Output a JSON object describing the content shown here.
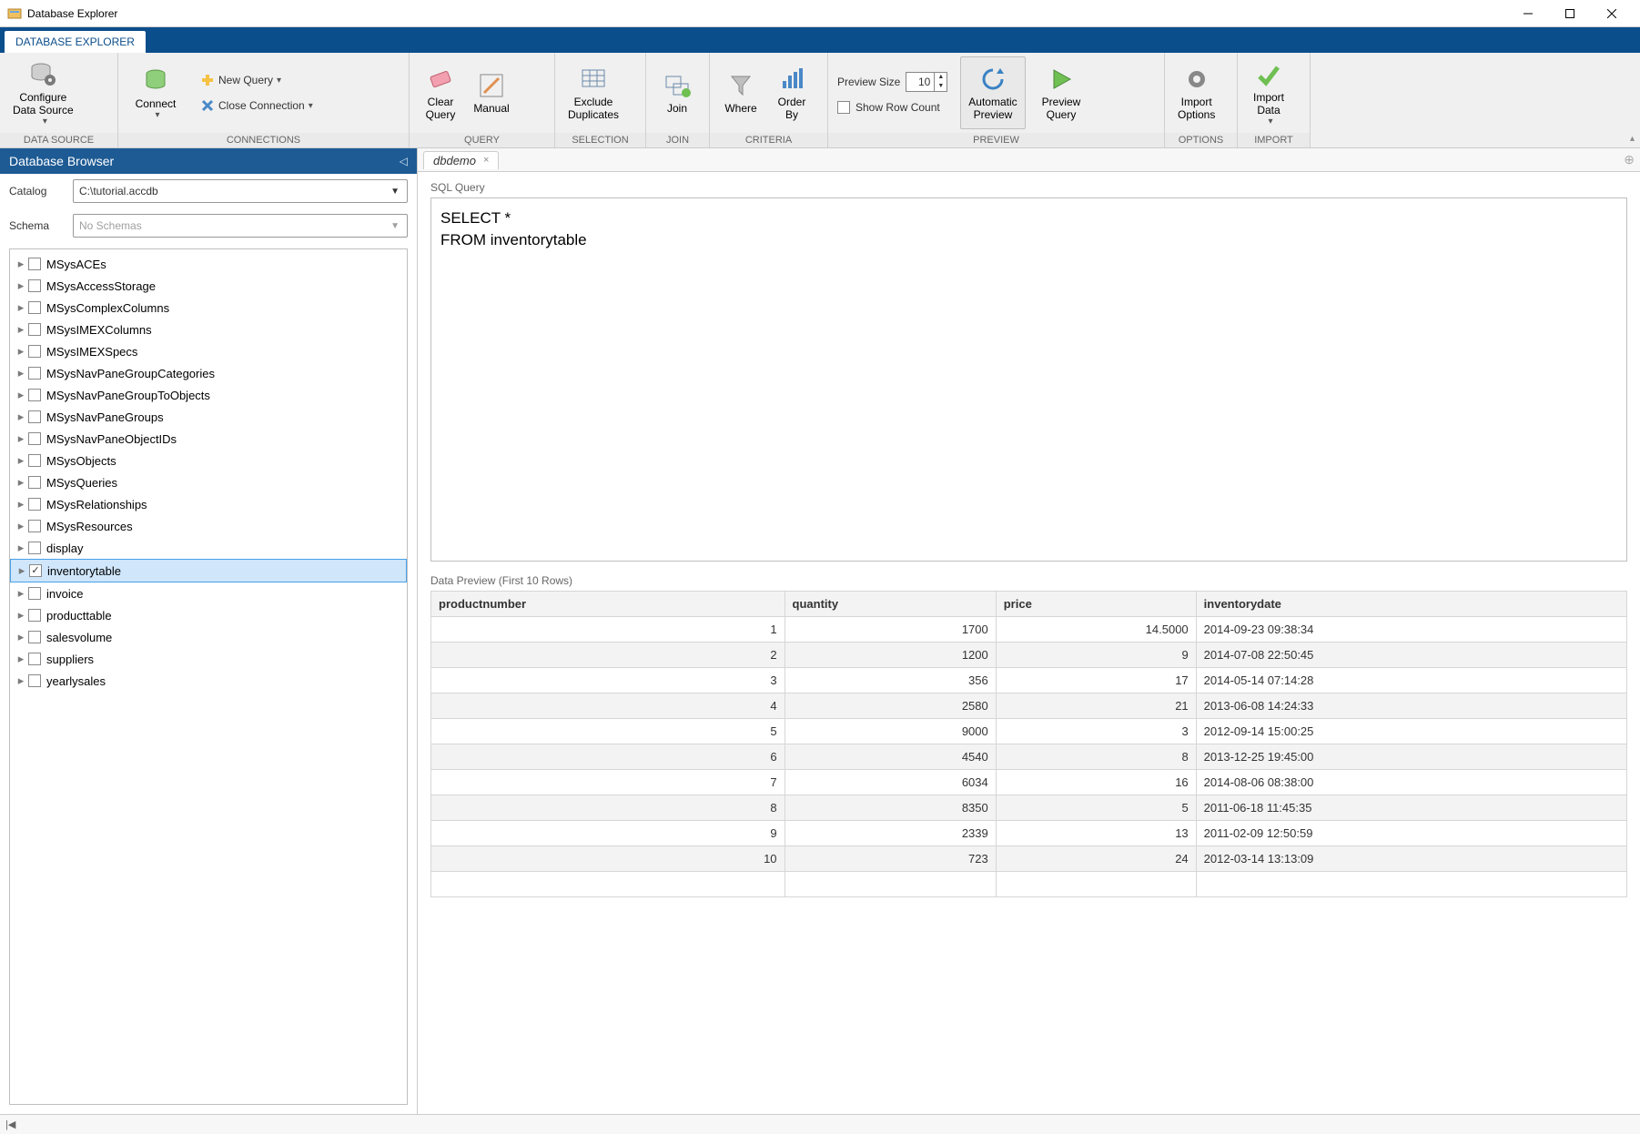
{
  "window": {
    "title": "Database Explorer"
  },
  "main_tab": "DATABASE EXPLORER",
  "ribbon": {
    "data_source": {
      "configure": "Configure\nData Source",
      "group": "DATA SOURCE"
    },
    "connections": {
      "connect": "Connect",
      "new_query": "New Query",
      "close_connection": "Close Connection",
      "group": "CONNECTIONS"
    },
    "query": {
      "clear": "Clear\nQuery",
      "manual": "Manual",
      "group": "QUERY"
    },
    "selection": {
      "exclude": "Exclude\nDuplicates",
      "group": "SELECTION"
    },
    "join": {
      "join": "Join",
      "group": "JOIN"
    },
    "criteria": {
      "where": "Where",
      "order_by": "Order\nBy",
      "group": "CRITERIA"
    },
    "preview": {
      "size_label": "Preview Size",
      "size_value": "10",
      "row_count": "Show Row Count",
      "auto": "Automatic\nPreview",
      "preview": "Preview\nQuery",
      "group": "PREVIEW"
    },
    "options": {
      "import_opts": "Import\nOptions",
      "group": "OPTIONS"
    },
    "import": {
      "import_data": "Import\nData",
      "group": "IMPORT"
    }
  },
  "sidebar": {
    "title": "Database Browser",
    "catalog_label": "Catalog",
    "catalog_value": "C:\\tutorial.accdb",
    "schema_label": "Schema",
    "schema_placeholder": "No Schemas",
    "tree": [
      {
        "name": "MSysACEs"
      },
      {
        "name": "MSysAccessStorage"
      },
      {
        "name": "MSysComplexColumns"
      },
      {
        "name": "MSysIMEXColumns"
      },
      {
        "name": "MSysIMEXSpecs"
      },
      {
        "name": "MSysNavPaneGroupCategories"
      },
      {
        "name": "MSysNavPaneGroupToObjects"
      },
      {
        "name": "MSysNavPaneGroups"
      },
      {
        "name": "MSysNavPaneObjectIDs"
      },
      {
        "name": "MSysObjects"
      },
      {
        "name": "MSysQueries"
      },
      {
        "name": "MSysRelationships"
      },
      {
        "name": "MSysResources"
      },
      {
        "name": "display"
      },
      {
        "name": "inventorytable",
        "checked": true,
        "selected": true
      },
      {
        "name": "invoice"
      },
      {
        "name": "producttable"
      },
      {
        "name": "salesvolume"
      },
      {
        "name": "suppliers"
      },
      {
        "name": "yearlysales"
      }
    ]
  },
  "doc_tab": "dbdemo",
  "sql_label": "SQL Query",
  "sql_text": "SELECT *\nFROM inventorytable",
  "preview_label": "Data Preview (First 10 Rows)",
  "table": {
    "headers": [
      "productnumber",
      "quantity",
      "price",
      "inventorydate"
    ],
    "rows": [
      [
        "1",
        "1700",
        "14.5000",
        "2014-09-23 09:38:34"
      ],
      [
        "2",
        "1200",
        "9",
        "2014-07-08 22:50:45"
      ],
      [
        "3",
        "356",
        "17",
        "2014-05-14 07:14:28"
      ],
      [
        "4",
        "2580",
        "21",
        "2013-06-08 14:24:33"
      ],
      [
        "5",
        "9000",
        "3",
        "2012-09-14 15:00:25"
      ],
      [
        "6",
        "4540",
        "8",
        "2013-12-25 19:45:00"
      ],
      [
        "7",
        "6034",
        "16",
        "2014-08-06 08:38:00"
      ],
      [
        "8",
        "8350",
        "5",
        "2011-06-18 11:45:35"
      ],
      [
        "9",
        "2339",
        "13",
        "2011-02-09 12:50:59"
      ],
      [
        "10",
        "723",
        "24",
        "2012-03-14 13:13:09"
      ]
    ]
  }
}
